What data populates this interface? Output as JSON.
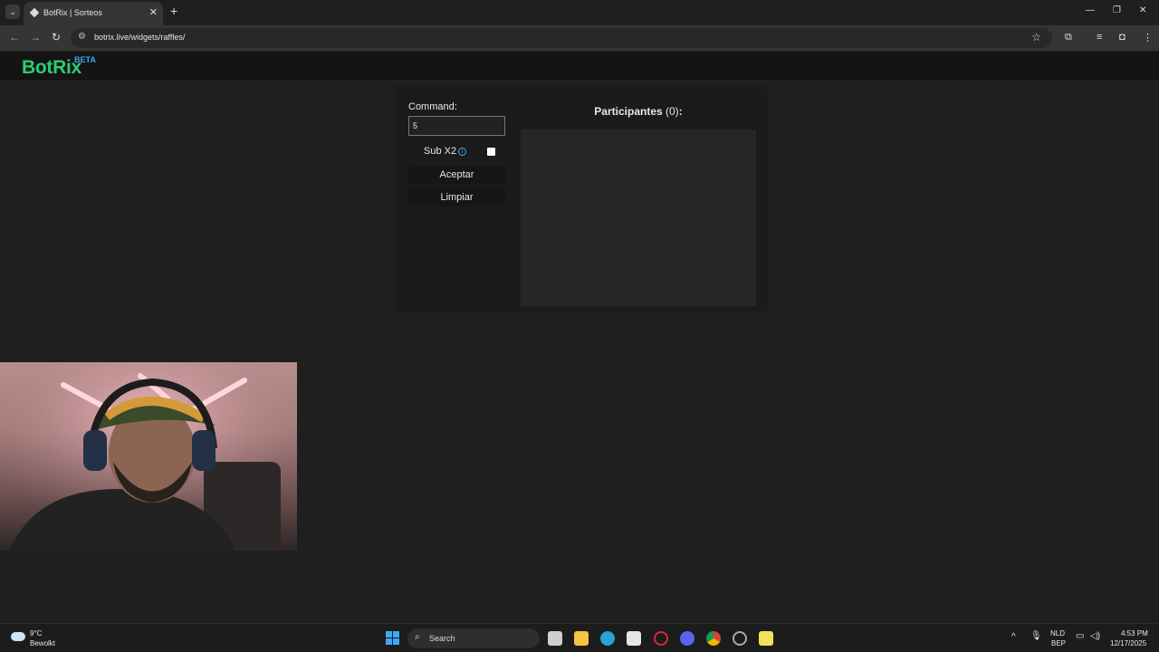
{
  "browser": {
    "tab_title": "BotRix | Sorteos",
    "tab_close": "✕",
    "new_tab": "+",
    "url": "botrix.live/widgets/raffles/"
  },
  "site": {
    "logo": "BotRix",
    "beta": "BETA"
  },
  "raffle": {
    "command_label": "Command:",
    "command_value": "5",
    "sub_label": "Sub X2",
    "sub_checked": false,
    "accept_label": "Aceptar",
    "clear_label": "Limpiar",
    "participants_label": "Participantes",
    "participants_count": "(0)",
    "participants_suffix": ":"
  },
  "taskbar": {
    "temperature": "9°C",
    "weather": "Bewolkt",
    "search_placeholder": "Search",
    "language": "NLD",
    "layout": "BEP",
    "time": "4:53 PM",
    "date": "12/17/2025"
  },
  "colors": {
    "brand_green": "#2ecc71",
    "beta_blue": "#3fa9f5"
  }
}
